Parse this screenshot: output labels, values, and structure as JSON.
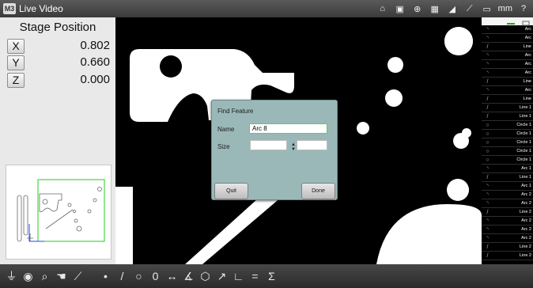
{
  "window": {
    "title": "Live Video",
    "app_icon_label": "M3"
  },
  "title_bar": {
    "units_label": "mm",
    "help_label": "?",
    "icons": [
      "home-icon",
      "video-camera-icon",
      "crosshair-icon",
      "grid-icon",
      "measure-icon",
      "probe-icon",
      "ruler-icon"
    ]
  },
  "stage": {
    "title": "Stage Position",
    "axes": [
      {
        "label": "X",
        "value": "0.802"
      },
      {
        "label": "Y",
        "value": "0.660"
      },
      {
        "label": "Z",
        "value": "0.000"
      }
    ]
  },
  "dialog": {
    "title": "Find Feature",
    "name_label": "Name",
    "name_value": "Arc 8",
    "size_label": "Size",
    "size_min": "",
    "size_max": "",
    "quit_label": "Quit",
    "done_label": "Done"
  },
  "feature_list": {
    "items": [
      {
        "type": "arc",
        "label": "Arc"
      },
      {
        "type": "arc",
        "label": "Arc"
      },
      {
        "type": "line",
        "label": "Line"
      },
      {
        "type": "arc",
        "label": "Arc"
      },
      {
        "type": "arc",
        "label": "Arc"
      },
      {
        "type": "arc",
        "label": "Arc"
      },
      {
        "type": "line",
        "label": "Line"
      },
      {
        "type": "arc",
        "label": "Arc"
      },
      {
        "type": "line",
        "label": "Line"
      },
      {
        "type": "line",
        "label": "Line 1"
      },
      {
        "type": "line",
        "label": "Line 1"
      },
      {
        "type": "circle",
        "label": "Circle 1"
      },
      {
        "type": "circle",
        "label": "Circle 1"
      },
      {
        "type": "circle",
        "label": "Circle 1"
      },
      {
        "type": "circle",
        "label": "Circle 1"
      },
      {
        "type": "circle",
        "label": "Circle 1"
      },
      {
        "type": "arc",
        "label": "Arc 1"
      },
      {
        "type": "line",
        "label": "Line 1"
      },
      {
        "type": "arc",
        "label": "Arc 1"
      },
      {
        "type": "arc",
        "label": "Arc 2"
      },
      {
        "type": "arc",
        "label": "Arc 2"
      },
      {
        "type": "line",
        "label": "Line 2"
      },
      {
        "type": "arc",
        "label": "Arc 2"
      },
      {
        "type": "arc",
        "label": "Arc 2"
      },
      {
        "type": "arc",
        "label": "Arc 2"
      },
      {
        "type": "line",
        "label": "Line 2"
      },
      {
        "type": "line",
        "label": "Line 2"
      }
    ]
  },
  "bottom_toolbar": {
    "tools": [
      {
        "name": "part-icon",
        "glyph": "⏚"
      },
      {
        "name": "light-icon",
        "glyph": "◉"
      },
      {
        "name": "zoom-icon",
        "glyph": "⌕"
      },
      {
        "name": "hand-probe-icon",
        "glyph": "☚"
      },
      {
        "name": "edge-tool-icon",
        "glyph": "⟋"
      },
      {
        "name": "point-tool-icon",
        "glyph": "•"
      },
      {
        "name": "line-tool-icon",
        "glyph": "/"
      },
      {
        "name": "circle-tool-icon",
        "glyph": "○"
      },
      {
        "name": "slot-tool-icon",
        "glyph": "0"
      },
      {
        "name": "distance-tool-icon",
        "glyph": "↔"
      },
      {
        "name": "angle-tool-icon",
        "glyph": "∡"
      },
      {
        "name": "plane-tool-icon",
        "glyph": "⬡"
      },
      {
        "name": "construct-tool-icon",
        "glyph": "↗"
      },
      {
        "name": "perpendicular-tool-icon",
        "glyph": "∟"
      },
      {
        "name": "equal-tool-icon",
        "glyph": "="
      },
      {
        "name": "sum-tool-icon",
        "glyph": "Σ"
      }
    ]
  },
  "colors": {
    "accent": "#9ab8b8",
    "input_active_border": "#6fc16f",
    "thumbnail_outline": "#22cc22",
    "axis_blue": "#2244ff"
  }
}
